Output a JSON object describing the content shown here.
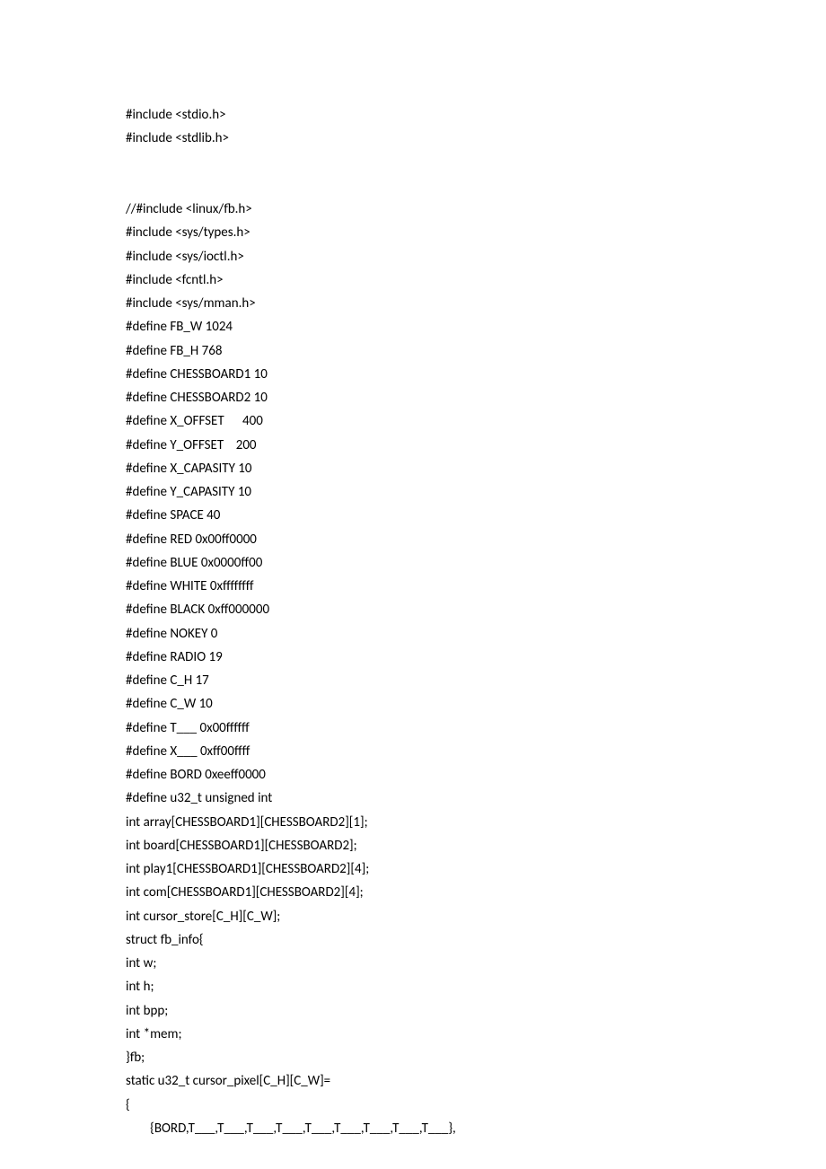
{
  "lines": [
    "#include <stdio.h>",
    "#include <stdlib.h>",
    "",
    "",
    "//#include <linux/fb.h>",
    "#include <sys/types.h>",
    "#include <sys/ioctl.h>",
    "#include <fcntl.h>",
    "#include <sys/mman.h>",
    "#define FB_W 1024",
    "#define FB_H 768",
    "#define CHESSBOARD1 10",
    "#define CHESSBOARD2 10",
    "#define X_OFFSET      400",
    "#define Y_OFFSET    200",
    "#define X_CAPASITY 10",
    "#define Y_CAPASITY 10",
    "#define SPACE 40",
    "#define RED 0x00ff0000",
    "#define BLUE 0x0000ff00",
    "#define WHITE 0xffffffff",
    "#define BLACK 0xff000000",
    "#define NOKEY 0",
    "#define RADIO 19",
    "#define C_H 17",
    "#define C_W 10",
    "#define T___ 0x00ffffff",
    "#define X___ 0xff00ffff",
    "#define BORD 0xeeff0000",
    "#define u32_t unsigned int",
    "int array[CHESSBOARD1][CHESSBOARD2][1];",
    "int board[CHESSBOARD1][CHESSBOARD2];",
    "int play1[CHESSBOARD1][CHESSBOARD2][4];",
    "int com[CHESSBOARD1][CHESSBOARD2][4];",
    "int cursor_store[C_H][C_W];",
    "struct fb_info{",
    "int w;",
    "int h;",
    "int bpp;",
    "int *mem;",
    "}fb;",
    "static u32_t cursor_pixel[C_H][C_W]=",
    "{",
    "        {BORD,T___,T___,T___,T___,T___,T___,T___,T___,T___},"
  ]
}
